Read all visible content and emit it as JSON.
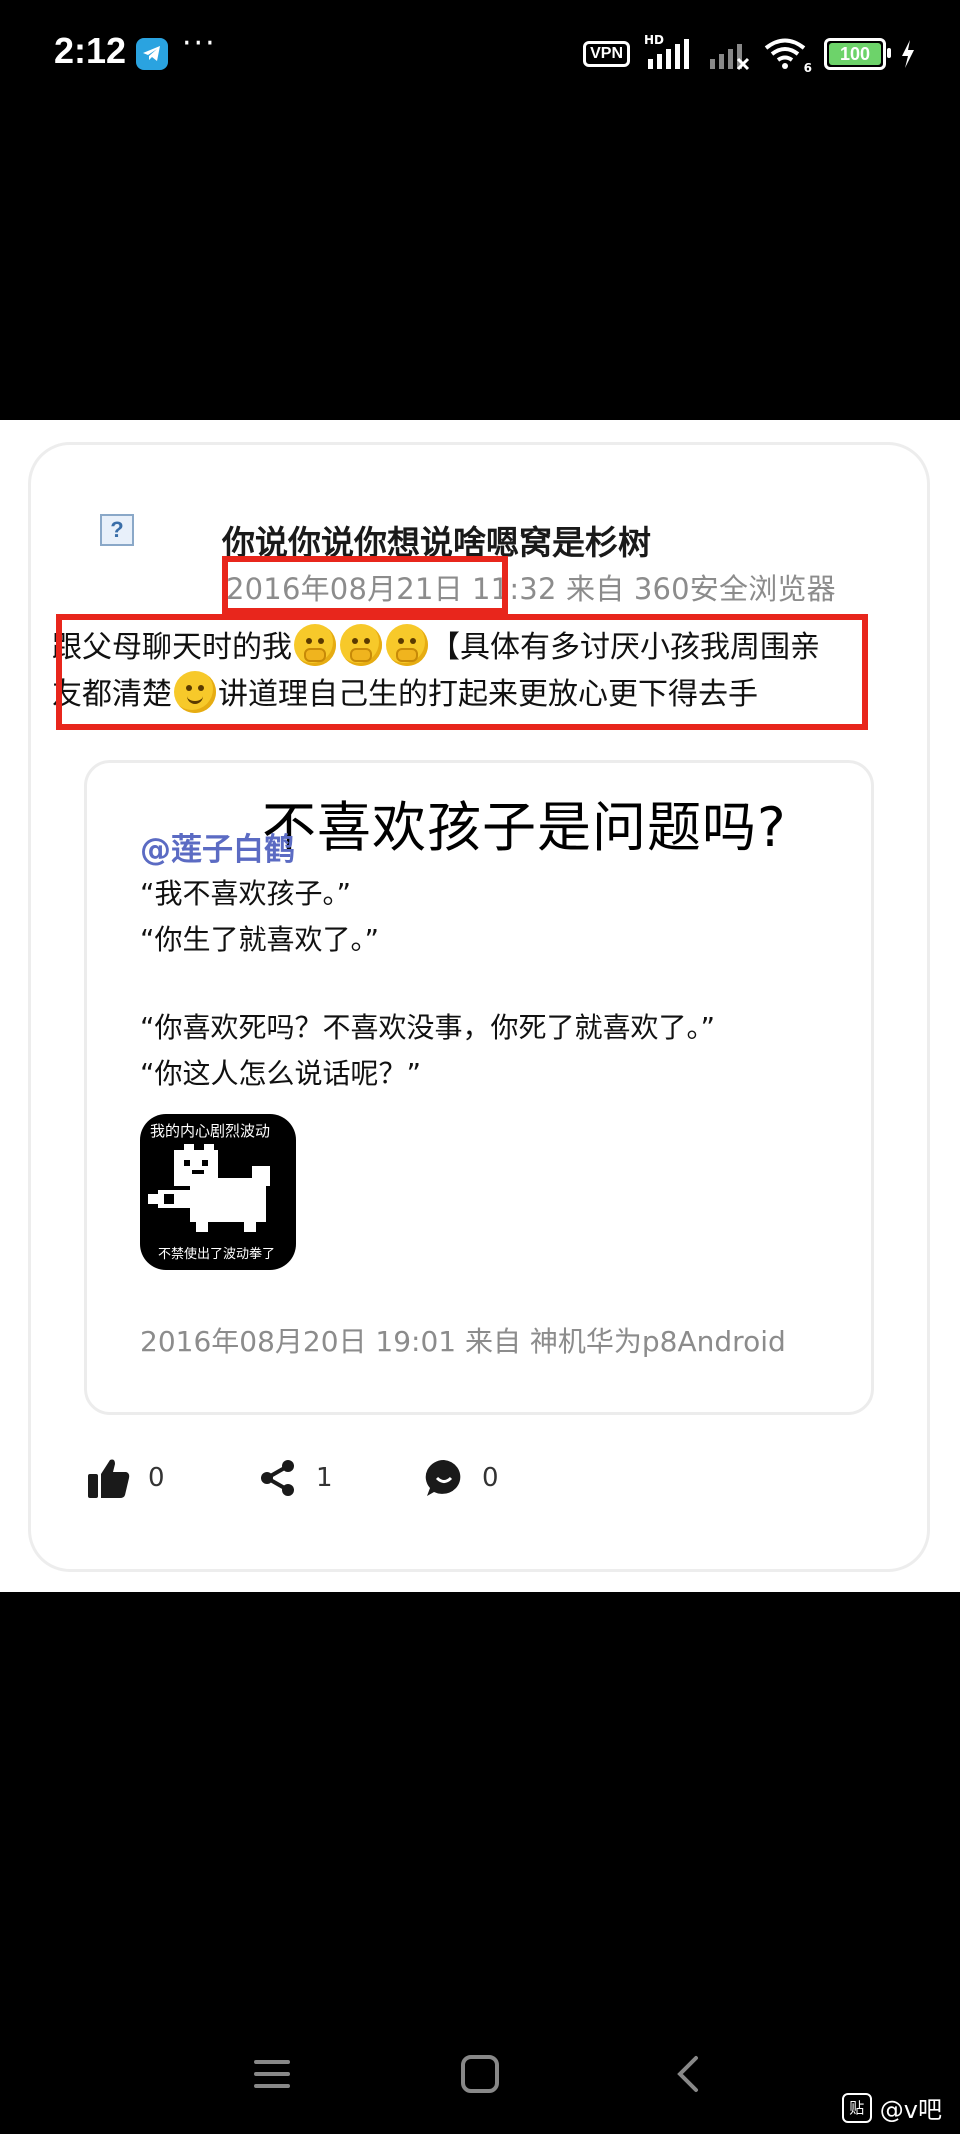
{
  "status_bar": {
    "time": "2:12",
    "dots": "···",
    "vpn": "VPN",
    "hd": "HD",
    "wifi_badge": "6",
    "battery": "100"
  },
  "post": {
    "avatar_placeholder": "?",
    "username": "你说你说你想说啥嗯窝是杉树",
    "meta": {
      "date": "2016年08月21日",
      "time_source": "11:32 来自 360安全浏览器"
    },
    "text": {
      "line1_before": "跟父母聊天时的我",
      "line1_after": "【具体有多讨厌小孩我周围亲",
      "line2_before": "友都清楚",
      "line2_after": "讲道理自己生的打起来更放心更下得去手"
    },
    "emojis": [
      "thinking-face",
      "thinking-face",
      "thinking-face",
      "slightly-smiling-face"
    ]
  },
  "quote": {
    "overlay_title": "不喜欢孩子是问题吗?",
    "author": "@莲子白鹤",
    "lines": [
      "“我不喜欢孩子。”",
      "“你生了就喜欢了。”",
      "“你喜欢死吗？不喜欢没事，你死了就喜欢了。”",
      "“你这人怎么说话呢？”"
    ],
    "image_caption_top": "我的内心剧烈波动",
    "image_caption_bottom": "不禁使出了波动拳了",
    "meta": "2016年08月20日 19:01 来自 神机华为p8Android"
  },
  "actions": {
    "like_count": "0",
    "share_count": "1",
    "comment_count": "0"
  },
  "watermark": {
    "icon_text": "贴",
    "handle": "@v吧"
  },
  "colors": {
    "highlight_red": "#e8261c",
    "author_blue": "#5b6bc3",
    "meta_gray": "#8c8c8c"
  }
}
